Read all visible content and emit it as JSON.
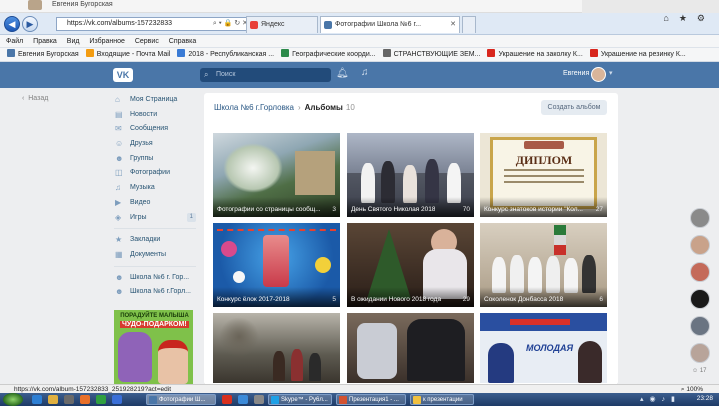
{
  "top_strip": {
    "name": "Евгения Бугорская"
  },
  "browser": {
    "url": "https://vk.com/albums-157232833",
    "tabs": [
      {
        "label": "Яндекс",
        "active": false,
        "color": "#e8403a"
      },
      {
        "label": "Фотографии Школа №6 г...",
        "active": true,
        "color": "#4a76a8"
      }
    ],
    "menu": [
      "Файл",
      "Правка",
      "Вид",
      "Избранное",
      "Сервис",
      "Справка"
    ],
    "favorites": [
      {
        "label": "Евгения Бугорская",
        "color": "#4a76a8"
      },
      {
        "label": "Входящие - Почта Mail",
        "color": "#f39c12"
      },
      {
        "label": "2018 - Республиканская ...",
        "color": "#3a7bd5"
      },
      {
        "label": "Географические коорди...",
        "color": "#2c8a4a"
      },
      {
        "label": "СТРАНСТВУЮЩИЕ ЗЕМ...",
        "color": "#666666"
      },
      {
        "label": "Украшение на заколку К...",
        "color": "#d8261d"
      },
      {
        "label": "Украшение на резинку К...",
        "color": "#d8261d"
      }
    ],
    "status_url": "https://vk.com/album-157232833_251928219?act=edit",
    "zoom": "100%"
  },
  "vk": {
    "logo": "VK",
    "search_placeholder": "Поиск",
    "user_name": "Евгения",
    "back_label": "Назад",
    "sidebar": [
      {
        "label": "Моя Страница",
        "icon": "home-icon",
        "glyph": "⌂"
      },
      {
        "label": "Новости",
        "icon": "news-icon",
        "glyph": "▤"
      },
      {
        "label": "Сообщения",
        "icon": "messages-icon",
        "glyph": "✉"
      },
      {
        "label": "Друзья",
        "icon": "friends-icon",
        "glyph": "☺"
      },
      {
        "label": "Группы",
        "icon": "groups-icon",
        "glyph": "☻"
      },
      {
        "label": "Фотографии",
        "icon": "photos-icon",
        "glyph": "◫"
      },
      {
        "label": "Музыка",
        "icon": "music-icon",
        "glyph": "♫"
      },
      {
        "label": "Видео",
        "icon": "video-icon",
        "glyph": "▶"
      },
      {
        "label": "Игры",
        "icon": "games-icon",
        "glyph": "◈",
        "count": "1"
      }
    ],
    "sidebar_secondary": [
      {
        "label": "Закладки",
        "icon": "bookmarks-icon",
        "glyph": "★"
      },
      {
        "label": "Документы",
        "icon": "documents-icon",
        "glyph": "▦"
      }
    ],
    "sidebar_groups": [
      {
        "label": "Школа №6 г. Гор...",
        "icon": "group-icon",
        "glyph": "☻"
      },
      {
        "label": "Школа №6 г.Горл...",
        "icon": "group-icon",
        "glyph": "☻"
      }
    ],
    "ad": {
      "line1": "ПОРАДУЙТЕ МАЛЫША",
      "line2": "ЧУДО-ПОДАРКОМ!"
    },
    "breadcrumb": {
      "group": "Школа №6 г.Горловка",
      "section": "Альбомы",
      "count": "10"
    },
    "create_album": "Создать альбом",
    "albums": [
      {
        "title": "Фотографии со страницы сообщ...",
        "count": "3"
      },
      {
        "title": "День Святого Николая 2018",
        "count": "70"
      },
      {
        "title": "Конкурс знатоков истории \"Кол...",
        "count": "27"
      },
      {
        "title": "Конкурс ёлок 2017-2018",
        "count": "5"
      },
      {
        "title": "В ожидании Нового 2018 года",
        "count": "29"
      },
      {
        "title": "Соколенок Донбасса 2018",
        "count": "6"
      },
      {
        "title": "",
        "count": ""
      },
      {
        "title": "",
        "count": ""
      },
      {
        "title": "",
        "count": ""
      }
    ],
    "chat_count": "17"
  },
  "taskbar": {
    "windows": [
      {
        "label": "Фотографии Ш...",
        "color": "#4a76a8"
      },
      {
        "label": "Skype™ - Ру6л...",
        "color": "#1ea0e6"
      },
      {
        "label": "Презентация1 - ...",
        "color": "#d35230"
      },
      {
        "label": "к презентации",
        "color": "#f0c040"
      }
    ],
    "clock": "23:28"
  }
}
